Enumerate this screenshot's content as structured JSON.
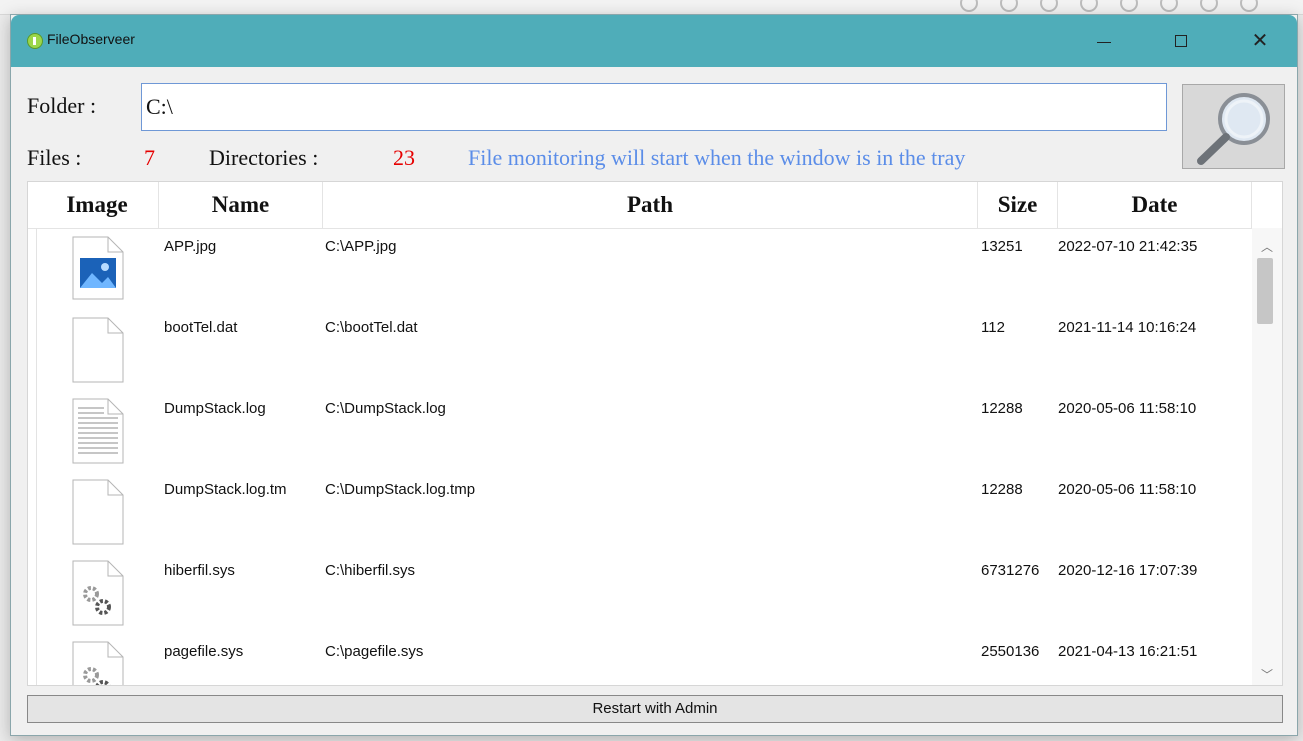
{
  "window": {
    "title": "FileObserveer"
  },
  "folder": {
    "label": "Folder :",
    "value": "C:\\"
  },
  "stats": {
    "files_label": "Files :",
    "files_count": "7",
    "dirs_label": "Directories :",
    "dirs_count": "23",
    "notice": "File monitoring will start when the window is in the tray"
  },
  "table": {
    "columns": [
      "Image",
      "Name",
      "Path",
      "Size",
      "Date"
    ],
    "rows": [
      {
        "icon": "image-file-icon",
        "name": "APP.jpg",
        "path": "C:\\APP.jpg",
        "size": "13251",
        "date": "2022-07-10 21:42:35"
      },
      {
        "icon": "blank-file-icon",
        "name": "bootTel.dat",
        "path": "C:\\bootTel.dat",
        "size": "112",
        "date": "2021-11-14 10:16:24"
      },
      {
        "icon": "text-file-icon",
        "name": "DumpStack.log",
        "path": "C:\\DumpStack.log",
        "size": "12288",
        "date": "2020-05-06 11:58:10"
      },
      {
        "icon": "blank-file-icon",
        "name": "DumpStack.log.tm",
        "path": "C:\\DumpStack.log.tmp",
        "size": "12288",
        "date": "2020-05-06 11:58:10"
      },
      {
        "icon": "system-file-icon",
        "name": "hiberfil.sys",
        "path": "C:\\hiberfil.sys",
        "size": "6731276",
        "date": "2020-12-16 17:07:39"
      },
      {
        "icon": "system-file-icon",
        "name": "pagefile.sys",
        "path": "C:\\pagefile.sys",
        "size": "2550136",
        "date": "2021-04-13 16:21:51"
      }
    ]
  },
  "restart_button": "Restart with Admin",
  "colors": {
    "titlebar": "#4fadb9",
    "count": "#e60000",
    "notice": "#5b8de8"
  }
}
